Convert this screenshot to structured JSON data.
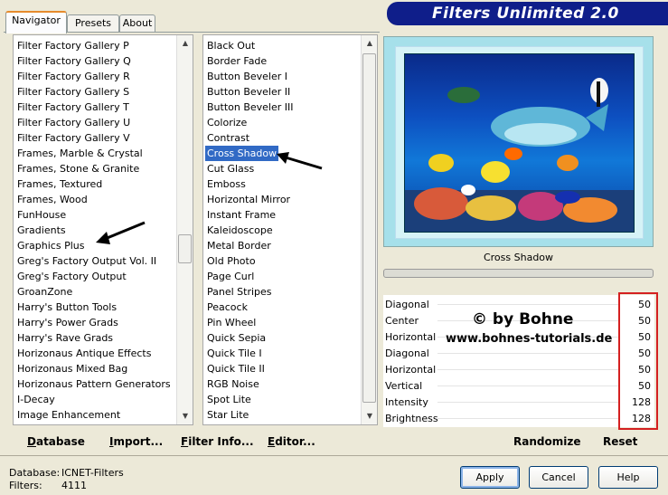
{
  "tabs": [
    "Navigator",
    "Presets",
    "About"
  ],
  "banner": {
    "title": "Filters Unlimited 2.0"
  },
  "categories": [
    "Filter Factory Gallery P",
    "Filter Factory Gallery Q",
    "Filter Factory Gallery R",
    "Filter Factory Gallery S",
    "Filter Factory Gallery T",
    "Filter Factory Gallery U",
    "Filter Factory Gallery V",
    "Frames, Marble & Crystal",
    "Frames, Stone & Granite",
    "Frames, Textured",
    "Frames, Wood",
    "FunHouse",
    "Gradients",
    "Graphics Plus",
    "Greg's Factory Output Vol. II",
    "Greg's Factory Output",
    "GroanZone",
    "Harry's Button Tools",
    "Harry's Power Grads",
    "Harry's Rave Grads",
    "Horizonaus Antique Effects",
    "Horizonaus Mixed Bag",
    "Horizonaus Pattern Generators",
    "I-Decay",
    "Image Enhancement"
  ],
  "filters": [
    "Black Out",
    "Border Fade",
    "Button Beveler I",
    "Button Beveler II",
    "Button Beveler III",
    "Colorize",
    "Contrast",
    "Cross Shadow",
    "Cut Glass",
    "Emboss",
    "Horizontal Mirror",
    "Instant Frame",
    "Kaleidoscope",
    "Metal Border",
    "Old Photo",
    "Page Curl",
    "Panel Stripes",
    "Peacock",
    "Pin Wheel",
    "Quick Sepia",
    "Quick Tile I",
    "Quick Tile II",
    "RGB Noise",
    "Spot Lite",
    "Star Lite"
  ],
  "selected_filter": "Cross Shadow",
  "toolbar": {
    "database": "Database",
    "import": "Import...",
    "filter_info": "Filter Info...",
    "editor": "Editor..."
  },
  "parameters": [
    {
      "label": "Diagonal",
      "value": "50"
    },
    {
      "label": "Center",
      "value": "50"
    },
    {
      "label": "Horizontal",
      "value": "50"
    },
    {
      "label": "Diagonal",
      "value": "50"
    },
    {
      "label": "Horizontal",
      "value": "50"
    },
    {
      "label": "Vertical",
      "value": "50"
    },
    {
      "label": "Intensity",
      "value": "128"
    },
    {
      "label": "Brightness",
      "value": "128"
    }
  ],
  "watermark": {
    "line1": "© by Bohne",
    "line2": "www.bohnes-tutorials.de"
  },
  "right_buttons": {
    "randomize": "Randomize",
    "reset": "Reset"
  },
  "footer": {
    "database_label": "Database:",
    "database_value": "ICNET-Filters",
    "filters_label": "Filters:",
    "filters_value": "4111",
    "apply": "Apply",
    "cancel": "Cancel",
    "help": "Help"
  },
  "colors": {
    "selection": "#316ac5",
    "banner": "#0f1e8a",
    "annotation_box": "#d42020"
  }
}
